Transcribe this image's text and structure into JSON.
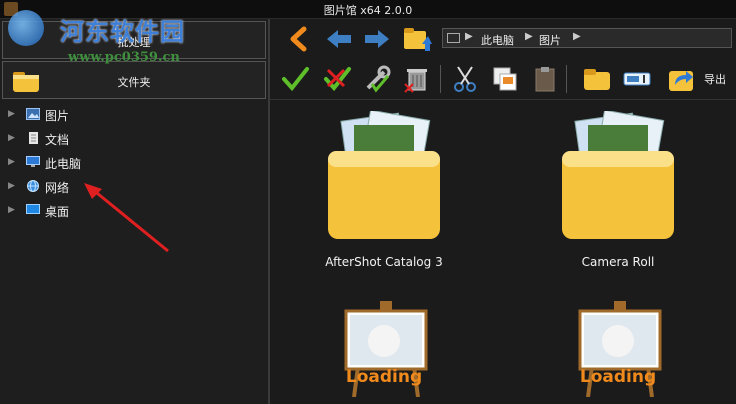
{
  "window": {
    "title": "图片馆 x64 2.0.0"
  },
  "watermark": {
    "name": "河东软件园",
    "url": "www.pc0359.cn"
  },
  "left": {
    "batch_label": "批处理",
    "folder_label": "文件夹",
    "tree": [
      {
        "label": "图片",
        "icon": "pictures-icon"
      },
      {
        "label": "文档",
        "icon": "documents-icon"
      },
      {
        "label": "此电脑",
        "icon": "computer-icon"
      },
      {
        "label": "网络",
        "icon": "network-icon"
      },
      {
        "label": "桌面",
        "icon": "desktop-icon"
      }
    ]
  },
  "toolbar": {
    "breadcrumb": [
      "此电脑",
      "图片"
    ],
    "export_label": "导出"
  },
  "items": [
    {
      "label": "AfterShot Catalog 3",
      "kind": "folder"
    },
    {
      "label": "Camera Roll",
      "kind": "folder"
    },
    {
      "label": "Loading",
      "kind": "loading"
    },
    {
      "label": "Loading",
      "kind": "loading"
    }
  ],
  "colors": {
    "accent_orange": "#f08a1c",
    "check_green": "#5fbf2a",
    "folder_yellow": "#f5c33b"
  }
}
